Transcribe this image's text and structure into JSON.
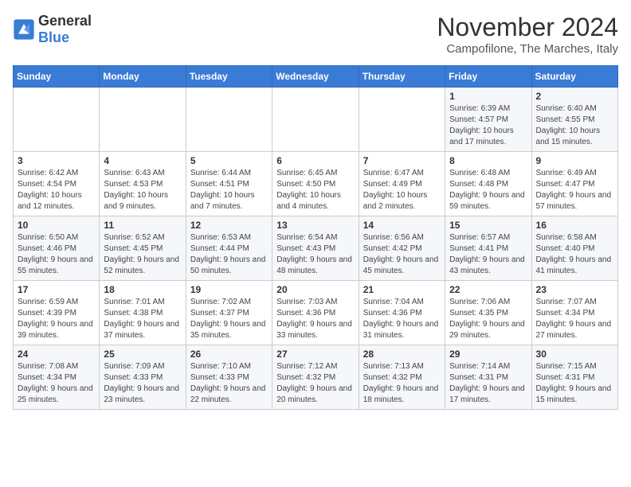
{
  "logo": {
    "general": "General",
    "blue": "Blue"
  },
  "title": "November 2024",
  "subtitle": "Campofilone, The Marches, Italy",
  "days_of_week": [
    "Sunday",
    "Monday",
    "Tuesday",
    "Wednesday",
    "Thursday",
    "Friday",
    "Saturday"
  ],
  "weeks": [
    [
      {
        "day": "",
        "info": ""
      },
      {
        "day": "",
        "info": ""
      },
      {
        "day": "",
        "info": ""
      },
      {
        "day": "",
        "info": ""
      },
      {
        "day": "",
        "info": ""
      },
      {
        "day": "1",
        "info": "Sunrise: 6:39 AM\nSunset: 4:57 PM\nDaylight: 10 hours and 17 minutes."
      },
      {
        "day": "2",
        "info": "Sunrise: 6:40 AM\nSunset: 4:55 PM\nDaylight: 10 hours and 15 minutes."
      }
    ],
    [
      {
        "day": "3",
        "info": "Sunrise: 6:42 AM\nSunset: 4:54 PM\nDaylight: 10 hours and 12 minutes."
      },
      {
        "day": "4",
        "info": "Sunrise: 6:43 AM\nSunset: 4:53 PM\nDaylight: 10 hours and 9 minutes."
      },
      {
        "day": "5",
        "info": "Sunrise: 6:44 AM\nSunset: 4:51 PM\nDaylight: 10 hours and 7 minutes."
      },
      {
        "day": "6",
        "info": "Sunrise: 6:45 AM\nSunset: 4:50 PM\nDaylight: 10 hours and 4 minutes."
      },
      {
        "day": "7",
        "info": "Sunrise: 6:47 AM\nSunset: 4:49 PM\nDaylight: 10 hours and 2 minutes."
      },
      {
        "day": "8",
        "info": "Sunrise: 6:48 AM\nSunset: 4:48 PM\nDaylight: 9 hours and 59 minutes."
      },
      {
        "day": "9",
        "info": "Sunrise: 6:49 AM\nSunset: 4:47 PM\nDaylight: 9 hours and 57 minutes."
      }
    ],
    [
      {
        "day": "10",
        "info": "Sunrise: 6:50 AM\nSunset: 4:46 PM\nDaylight: 9 hours and 55 minutes."
      },
      {
        "day": "11",
        "info": "Sunrise: 6:52 AM\nSunset: 4:45 PM\nDaylight: 9 hours and 52 minutes."
      },
      {
        "day": "12",
        "info": "Sunrise: 6:53 AM\nSunset: 4:44 PM\nDaylight: 9 hours and 50 minutes."
      },
      {
        "day": "13",
        "info": "Sunrise: 6:54 AM\nSunset: 4:43 PM\nDaylight: 9 hours and 48 minutes."
      },
      {
        "day": "14",
        "info": "Sunrise: 6:56 AM\nSunset: 4:42 PM\nDaylight: 9 hours and 45 minutes."
      },
      {
        "day": "15",
        "info": "Sunrise: 6:57 AM\nSunset: 4:41 PM\nDaylight: 9 hours and 43 minutes."
      },
      {
        "day": "16",
        "info": "Sunrise: 6:58 AM\nSunset: 4:40 PM\nDaylight: 9 hours and 41 minutes."
      }
    ],
    [
      {
        "day": "17",
        "info": "Sunrise: 6:59 AM\nSunset: 4:39 PM\nDaylight: 9 hours and 39 minutes."
      },
      {
        "day": "18",
        "info": "Sunrise: 7:01 AM\nSunset: 4:38 PM\nDaylight: 9 hours and 37 minutes."
      },
      {
        "day": "19",
        "info": "Sunrise: 7:02 AM\nSunset: 4:37 PM\nDaylight: 9 hours and 35 minutes."
      },
      {
        "day": "20",
        "info": "Sunrise: 7:03 AM\nSunset: 4:36 PM\nDaylight: 9 hours and 33 minutes."
      },
      {
        "day": "21",
        "info": "Sunrise: 7:04 AM\nSunset: 4:36 PM\nDaylight: 9 hours and 31 minutes."
      },
      {
        "day": "22",
        "info": "Sunrise: 7:06 AM\nSunset: 4:35 PM\nDaylight: 9 hours and 29 minutes."
      },
      {
        "day": "23",
        "info": "Sunrise: 7:07 AM\nSunset: 4:34 PM\nDaylight: 9 hours and 27 minutes."
      }
    ],
    [
      {
        "day": "24",
        "info": "Sunrise: 7:08 AM\nSunset: 4:34 PM\nDaylight: 9 hours and 25 minutes."
      },
      {
        "day": "25",
        "info": "Sunrise: 7:09 AM\nSunset: 4:33 PM\nDaylight: 9 hours and 23 minutes."
      },
      {
        "day": "26",
        "info": "Sunrise: 7:10 AM\nSunset: 4:33 PM\nDaylight: 9 hours and 22 minutes."
      },
      {
        "day": "27",
        "info": "Sunrise: 7:12 AM\nSunset: 4:32 PM\nDaylight: 9 hours and 20 minutes."
      },
      {
        "day": "28",
        "info": "Sunrise: 7:13 AM\nSunset: 4:32 PM\nDaylight: 9 hours and 18 minutes."
      },
      {
        "day": "29",
        "info": "Sunrise: 7:14 AM\nSunset: 4:31 PM\nDaylight: 9 hours and 17 minutes."
      },
      {
        "day": "30",
        "info": "Sunrise: 7:15 AM\nSunset: 4:31 PM\nDaylight: 9 hours and 15 minutes."
      }
    ]
  ]
}
